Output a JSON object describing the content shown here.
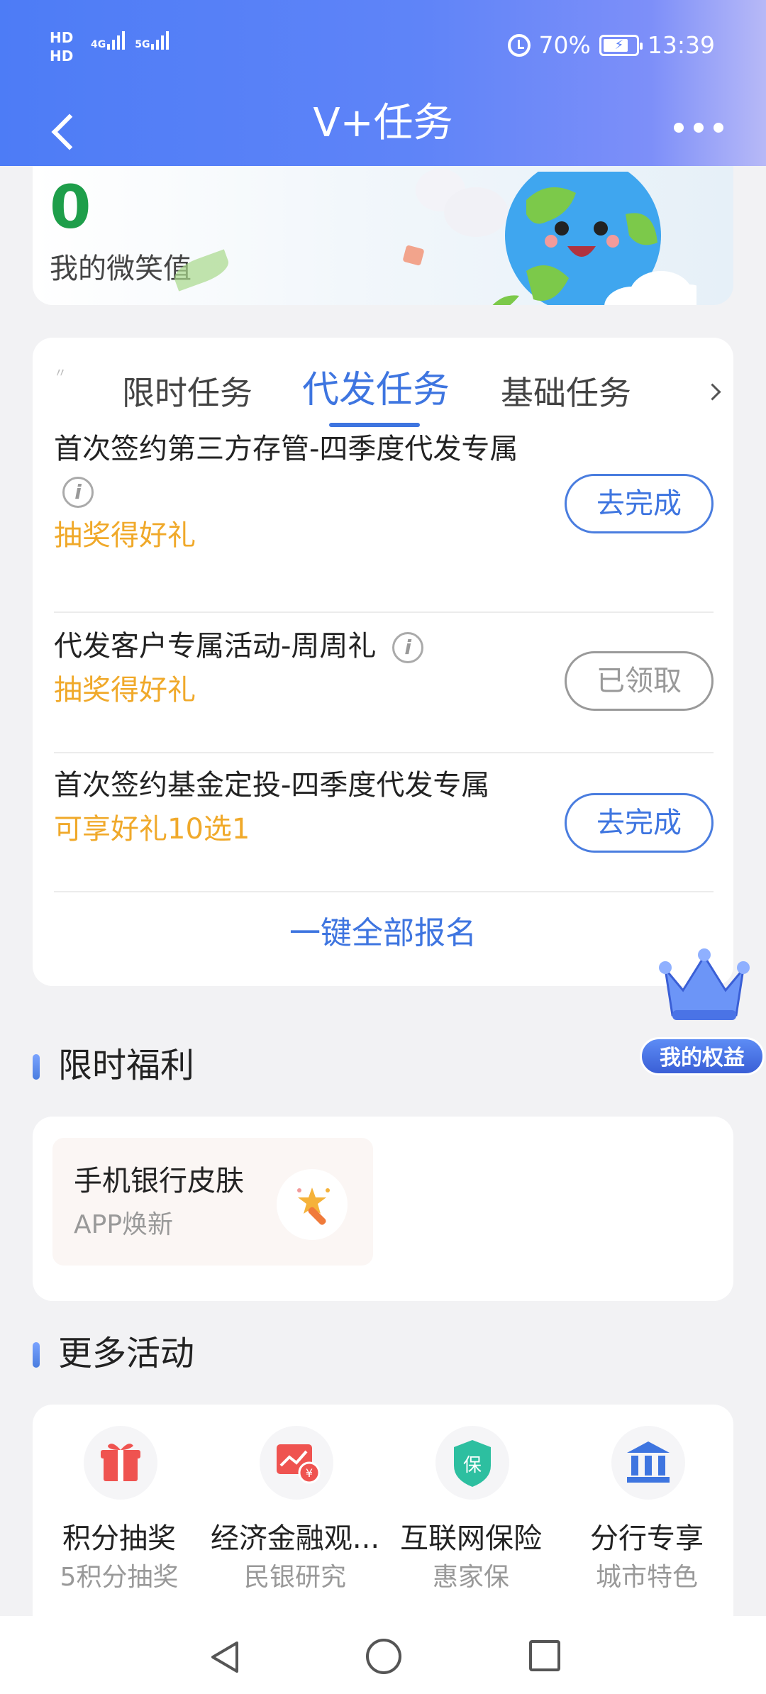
{
  "status_bar": {
    "hd1": "HD",
    "hd2": "HD",
    "net1": "4G",
    "net2": "5G",
    "battery": "70%",
    "time": "13:39"
  },
  "nav": {
    "title": "V+任务"
  },
  "smile": {
    "value": "0",
    "label": "我的微笑值"
  },
  "tabs": [
    {
      "label": "限时任务",
      "active": false
    },
    {
      "label": "代发任务",
      "active": true
    },
    {
      "label": "基础任务",
      "active": false
    }
  ],
  "tasks": [
    {
      "name": "首次签约第三方存管-四季度代发专属",
      "reward": "抽奖得好礼",
      "button": "去完成",
      "has_info": true
    },
    {
      "name": "代发客户专属活动-周周礼",
      "reward": "抽奖得好礼",
      "button": "已领取",
      "has_info": true
    },
    {
      "name": "首次签约基金定投-四季度代发专属",
      "reward": "可享好礼10选1",
      "button": "去完成",
      "has_info": false
    }
  ],
  "signup_all": "一键全部报名",
  "rights_label": "我的权益",
  "sections": {
    "limited_welfare": "限时福利",
    "more_activities": "更多活动"
  },
  "welfare": {
    "title": "手机银行皮肤",
    "subtitle": "APP焕新",
    "icon": "magic-wand-icon"
  },
  "activities": [
    {
      "title": "积分抽奖",
      "subtitle": "5积分抽奖",
      "icon": "gift-icon"
    },
    {
      "title": "经济金融观...",
      "subtitle": "民银研究",
      "icon": "chart-report-icon"
    },
    {
      "title": "互联网保险",
      "subtitle": "惠家保",
      "icon": "shield-insurance-icon"
    },
    {
      "title": "分行专享",
      "subtitle": "城市特色",
      "icon": "bank-building-icon"
    }
  ],
  "colors": {
    "accent": "#3e75e0",
    "smile_value": "#1e9e4a",
    "reward": "#f0a92a"
  }
}
